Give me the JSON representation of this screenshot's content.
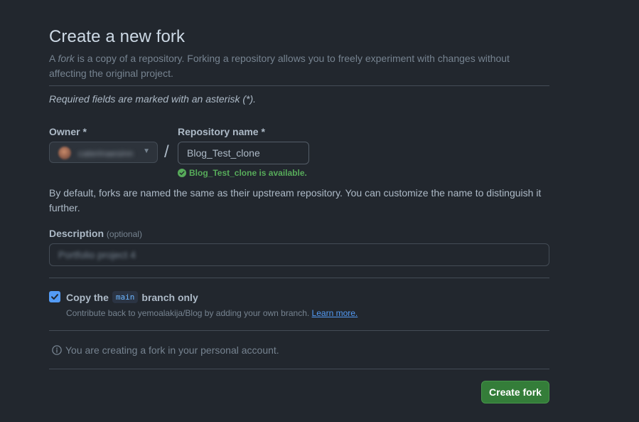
{
  "page": {
    "title": "Create a new fork",
    "intro_prefix": "A ",
    "intro_em": "fork",
    "intro_suffix": " is a copy of a repository. Forking a repository allows you to freely experiment with changes without affecting the original project.",
    "required_note": "Required fields are marked with an asterisk (*)."
  },
  "owner": {
    "label": "Owner *",
    "selected": "caterinaesinn"
  },
  "repo": {
    "label": "Repository name *",
    "value": "Blog_Test_clone",
    "availability": "Blog_Test_clone is available."
  },
  "naming_help": "By default, forks are named the same as their upstream repository. You can customize the name to distinguish it further.",
  "description": {
    "label": "Description",
    "optional": "(optional)",
    "value": "Portfolio project 4"
  },
  "copy_branch": {
    "checked": true,
    "label_prefix": "Copy the",
    "branch": "main",
    "label_suffix": "branch only",
    "note": "Contribute back to yemoalakija/Blog by adding your own branch.",
    "learn_more": "Learn more."
  },
  "account_note": "You are creating a fork in your personal account.",
  "submit": {
    "label": "Create fork"
  },
  "colors": {
    "background": "#22272e",
    "accent_blue": "#539bf5",
    "success_green": "#57ab5a",
    "button_green": "#347d39"
  },
  "icons": {
    "owner_caret": "triangle-down-icon",
    "availability": "check-circle-icon",
    "checkbox": "checkmark-icon",
    "info": "info-icon"
  }
}
